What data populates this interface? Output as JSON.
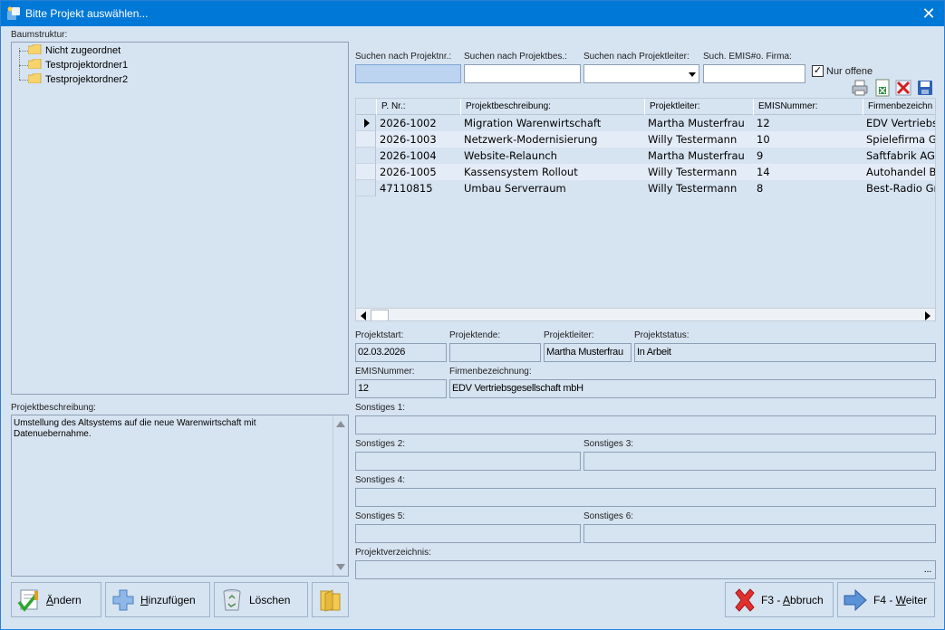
{
  "window": {
    "title": "Bitte Projekt auswählen...",
    "close": "✕"
  },
  "tree": {
    "label": "Baumstruktur:",
    "items": [
      "Nicht zugeordnet",
      "Testprojektordner1",
      "Testprojektordner2"
    ]
  },
  "description": {
    "label": "Projektbeschreibung:",
    "text": "Umstellung des Altsystems auf die neue Warenwirtschaft mit\nDatenuebernahme."
  },
  "buttons": {
    "aendern": {
      "underline": "Ä",
      "rest": "ndern"
    },
    "hinzufuegen": {
      "underline": "H",
      "rest": "inzufügen"
    },
    "loeschen": {
      "label": "Löschen"
    },
    "abbruch": {
      "prefix": "F3 - ",
      "underline": "A",
      "rest": "bbruch"
    },
    "weiter": {
      "prefix": "F4 - ",
      "underline": "W",
      "rest": "eiter"
    }
  },
  "search": {
    "nr_label": "Suchen nach Projektnr.:",
    "desc_label": "Suchen nach Projektbes.:",
    "lead_label": "Suchen nach Projektleiter:",
    "emis_label": "Such. EMIS#o. Firma:",
    "nr_value": "",
    "desc_value": "",
    "lead_value": "",
    "emis_value": "",
    "only_open_label": "Nur offene",
    "only_open_checked": "✓"
  },
  "grid": {
    "columns": [
      "P. Nr.:",
      "Projektbeschreibung:",
      "Projektleiter:",
      "EMISNummer:",
      "Firmenbezeichn"
    ],
    "rows": [
      [
        "2026-1002",
        "Migration Warenwirtschaft",
        "Martha Musterfrau",
        "12",
        "EDV Vertriebsg"
      ],
      [
        "2026-1003",
        "Netzwerk-Modernisierung",
        "Willy Testermann",
        "10",
        "Spielefirma Gr"
      ],
      [
        "2026-1004",
        "Website-Relaunch",
        "Martha Musterfrau",
        "9",
        "Saftfabrik AG"
      ],
      [
        "2026-1005",
        "Kassensystem Rollout",
        "Willy Testermann",
        "14",
        "Autohandel Ba"
      ],
      [
        "47110815",
        "Umbau Serverraum",
        "Willy Testermann",
        "8",
        "Best-Radio Gm"
      ]
    ]
  },
  "details": {
    "start_label": "Projektstart:",
    "start_value": "02.03.2026",
    "end_label": "Projektende:",
    "end_value": "",
    "lead_label": "Projektleiter:",
    "lead_value": "Martha Musterfrau",
    "status_label": "Projektstatus:",
    "status_value": "In Arbeit",
    "emis_label": "EMISNummer:",
    "emis_value": "12",
    "firm_label": "Firmenbezeichnung:",
    "firm_value": "EDV Vertriebsgesellschaft mbH",
    "s1_label": "Sonstiges 1:",
    "s2_label": "Sonstiges 2:",
    "s3_label": "Sonstiges 3:",
    "s4_label": "Sonstiges 4:",
    "s5_label": "Sonstiges 5:",
    "s6_label": "Sonstiges 6:",
    "dir_label": "Projektverzeichnis:",
    "dir_button": "..."
  },
  "icons": {
    "app": "app-icon",
    "folder": "folder-icon",
    "print": "printer-icon",
    "excel": "excel-export-icon",
    "delete": "red-x-icon",
    "save": "save-disk-icon",
    "edit": "checkmark-edit-icon",
    "add": "plus-icon",
    "trash": "recycle-bin-icon",
    "open_folder": "folder-open-icon",
    "cancel": "red-x-icon",
    "next": "arrow-right-icon"
  },
  "colors": {
    "titlebar": "#0078d7",
    "panel": "#d6e3f1",
    "active_search": "#bcd4ef"
  }
}
